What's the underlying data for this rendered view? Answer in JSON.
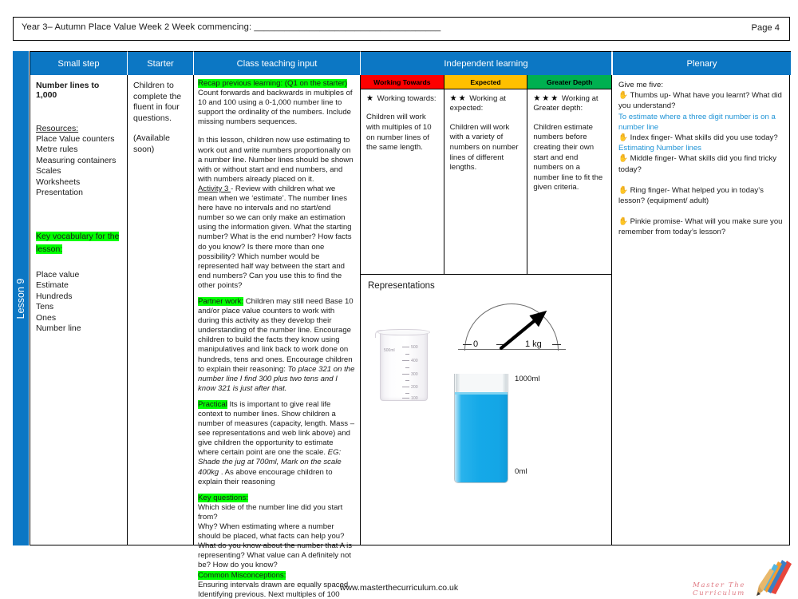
{
  "header": {
    "title": "Year 3– Autumn Place Value Week 2 Week commencing: _____________________________________",
    "page_label": "Page 4"
  },
  "lesson_tab": {
    "label": "Lesson 9",
    "color": "#0c77c4"
  },
  "table": {
    "columns": [
      {
        "key": "small_step",
        "label": "Small step"
      },
      {
        "key": "starter",
        "label": "Starter"
      },
      {
        "key": "class_teaching_input",
        "label": "Class teaching input"
      },
      {
        "key": "independent_learning",
        "label": "Independent learning"
      },
      {
        "key": "plenary",
        "label": "Plenary"
      }
    ],
    "header_bg": "#0c77c4",
    "header_fg": "#ffffff"
  },
  "small_step": {
    "title": "Number lines to 1,000",
    "resources_label": "Resources:",
    "resources": [
      "Place Value counters",
      "Metre rules",
      "Measuring containers",
      "Scales",
      "Worksheets",
      "Presentation"
    ],
    "vocab_heading": "Key vocabulary for the lesson:",
    "vocab_highlight_color": "#00ff00",
    "vocabulary": [
      "Place value",
      "Estimate",
      "Hundreds",
      "Tens",
      "Ones",
      "Number line"
    ]
  },
  "starter": {
    "line1": "Children to complete the fluent in four questions.",
    "line2": "(Available soon)"
  },
  "class_teaching_input": {
    "recap_heading": "Recap previous learning: (Q1 on the starter)",
    "recap_body": "Count forwards and backwards in multiples of 10 and 100 using a 0-1,000 number line to support the ordinality of the numbers.  Include missing numbers sequences.",
    "intro_body": "In this lesson, children now use estimating to work out and write numbers proportionally on a number line. Number lines should be shown with or without start and end numbers, and with numbers already placed on it.",
    "activity_label": "Activity 3 ",
    "activity_body": "- Review with children what we mean when we ‘estimate’.  The number lines here have no intervals and no start/end number so we can only make an estimation using the information given.  What  the starting number? What is the end number?  How facts do you know? Is there more than one possibility? Which number would be represented half way between the start and end numbers?  Can you use this to find the other points?",
    "partner_heading": "Partner work:",
    "partner_body": " Children may still need Base 10 and/or place value counters to work with during this activity as they develop their understanding of the number line.  Encourage children to build the facts they know using manipulatives and link back to work done on hundreds, tens and ones. Encourage children to explain their reasoning: ",
    "partner_italic": "To place 321 on the number line I find 300 plus two tens and I know 321 is just after that.",
    "practical_heading": "Practical",
    "practical_body": " Its is important to give real life context to number lines. Show children a number of measures (capacity, length. Mass – see representations and web link above) and give children the opportunity to estimate where certain point are one the scale. ",
    "practical_italic": "EG: Shade the jug at 700ml, Mark on the scale 400kg ",
    "practical_tail": ". As above encourage children to explain their reasoning",
    "key_questions_heading": "Key questions:",
    "key_questions_body": "Which side of the number line did you start from?",
    "key_questions_body2": "Why? When estimating where a number should be placed, what facts can help you? What do you know about the number that A is representing? What value can A definitely not be? How do you know?",
    "misconceptions_heading": "Common Misconceptions:",
    "misconceptions_body": "Ensuring intervals drawn are equally spaced.",
    "misconceptions_body2": "Identifying previous. Next multiples of 100"
  },
  "independent_learning": {
    "bands": [
      {
        "label": "Working Towards",
        "color": "#fe0000",
        "stars": "★",
        "star_count": 1,
        "lead": "Working towards:",
        "description": "Children will work with multiples of 10 on number lines of the same length."
      },
      {
        "label": "Expected",
        "color": "#ffc000",
        "stars": "★★",
        "star_count": 2,
        "lead": "Working at expected:",
        "description": "Children will work with a variety of numbers on number lines of different lengths."
      },
      {
        "label": "Greater Depth",
        "color": "#00b050",
        "stars": "★★★",
        "star_count": 3,
        "lead": "Working at Greater depth:",
        "description": "Children estimate numbers before creating their own start and end numbers on a number line to fit the\ngiven criteria."
      }
    ],
    "representations_title": "Representations",
    "graphics": {
      "beaker": {
        "name": "measuring-beaker",
        "capacity_label": "500ml",
        "ticks": [
          "500",
          "400",
          "300",
          "200",
          "100"
        ]
      },
      "scale_dial": {
        "name": "weighing-scale-dial",
        "min_label": "0",
        "max_label": "1 kg"
      },
      "water_jug": {
        "name": "water-jug",
        "top_label": "1000ml",
        "bottom_label": "0ml",
        "water_color": "#15a9e8"
      }
    }
  },
  "plenary": {
    "heading": "Give me five:",
    "hand_icon": "✋",
    "items": [
      {
        "prompt": "Thumbs up- What have you learnt? What did you understand?",
        "answer": "To estimate where a three digit number is on a number line"
      },
      {
        "prompt": "Index finger- What skills did you use today?",
        "answer": "Estimating Number lines"
      },
      {
        "prompt": "Middle finger- What skills did you find tricky today?",
        "answer": ""
      },
      {
        "prompt": "Ring finger- What helped you in today’s lesson? (equipment/ adult)",
        "answer": ""
      },
      {
        "prompt": "Pinkie promise- What will you make sure you remember from today’s lesson?",
        "answer": ""
      }
    ],
    "answer_color": "#1e93d6"
  },
  "footer": {
    "url": "www.masterthecurriculum.co.uk",
    "logo_text": "Master  The  Curriculum"
  }
}
